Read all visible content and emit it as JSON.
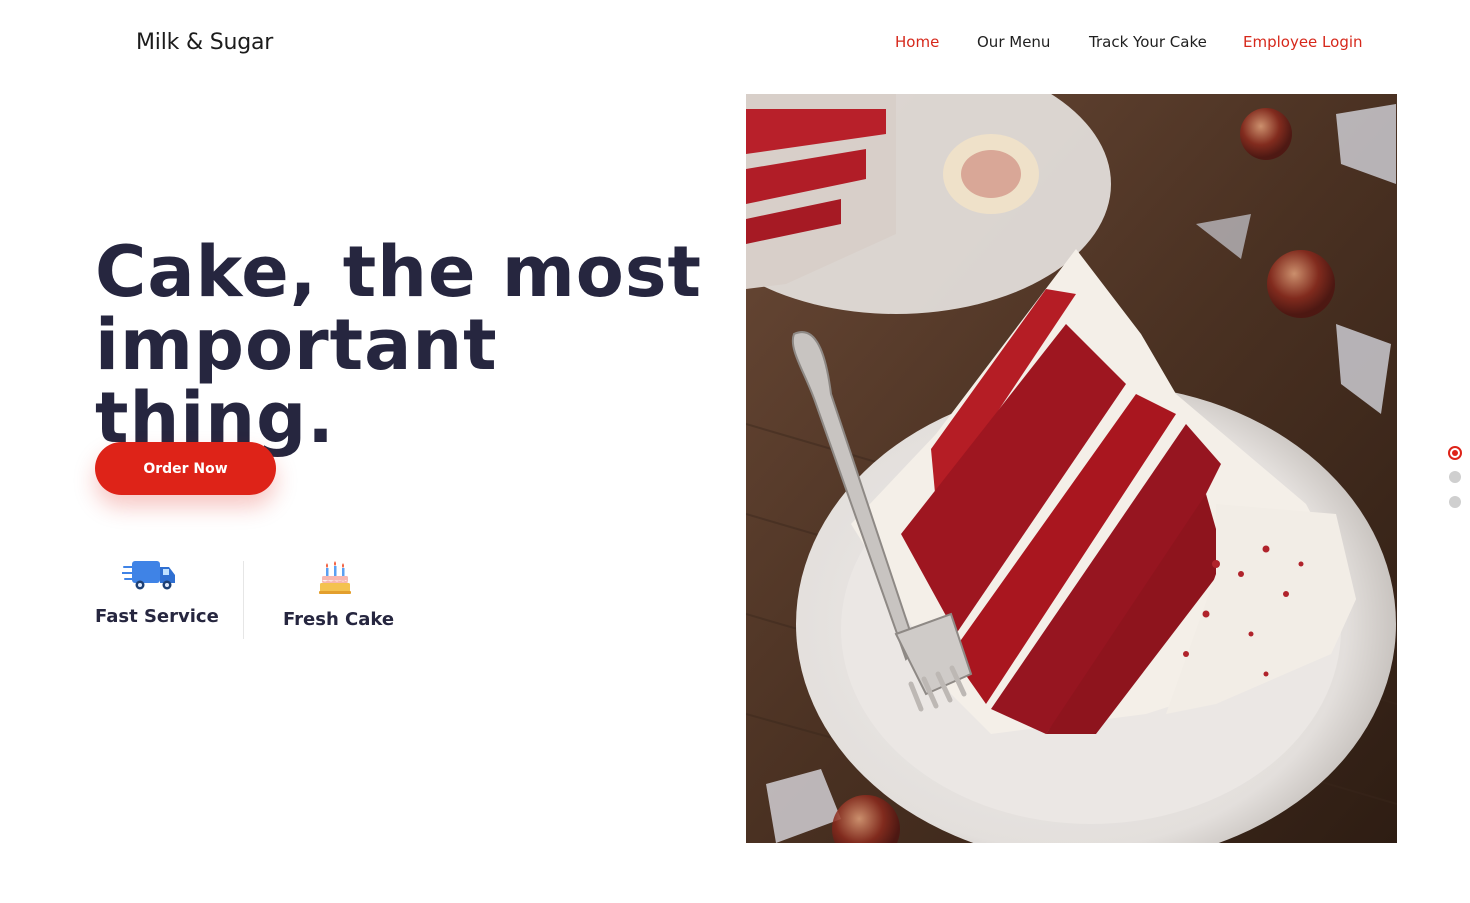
{
  "brand": {
    "name": "Milk & Sugar"
  },
  "nav": {
    "home": "Home",
    "menu": "Our Menu",
    "track": "Track Your Cake",
    "login": "Employee Login"
  },
  "hero": {
    "title_line1": "Cake, the most",
    "title_line2": "important thing.",
    "cta": "Order Now"
  },
  "features": [
    {
      "label": "Fast Service",
      "icon": "delivery-truck-icon"
    },
    {
      "label": "Fresh Cake",
      "icon": "birthday-cake-icon"
    }
  ],
  "carousel": {
    "slides": 3,
    "active_slide": 1
  },
  "colors": {
    "accent": "#de2318",
    "heading": "#26263f"
  }
}
